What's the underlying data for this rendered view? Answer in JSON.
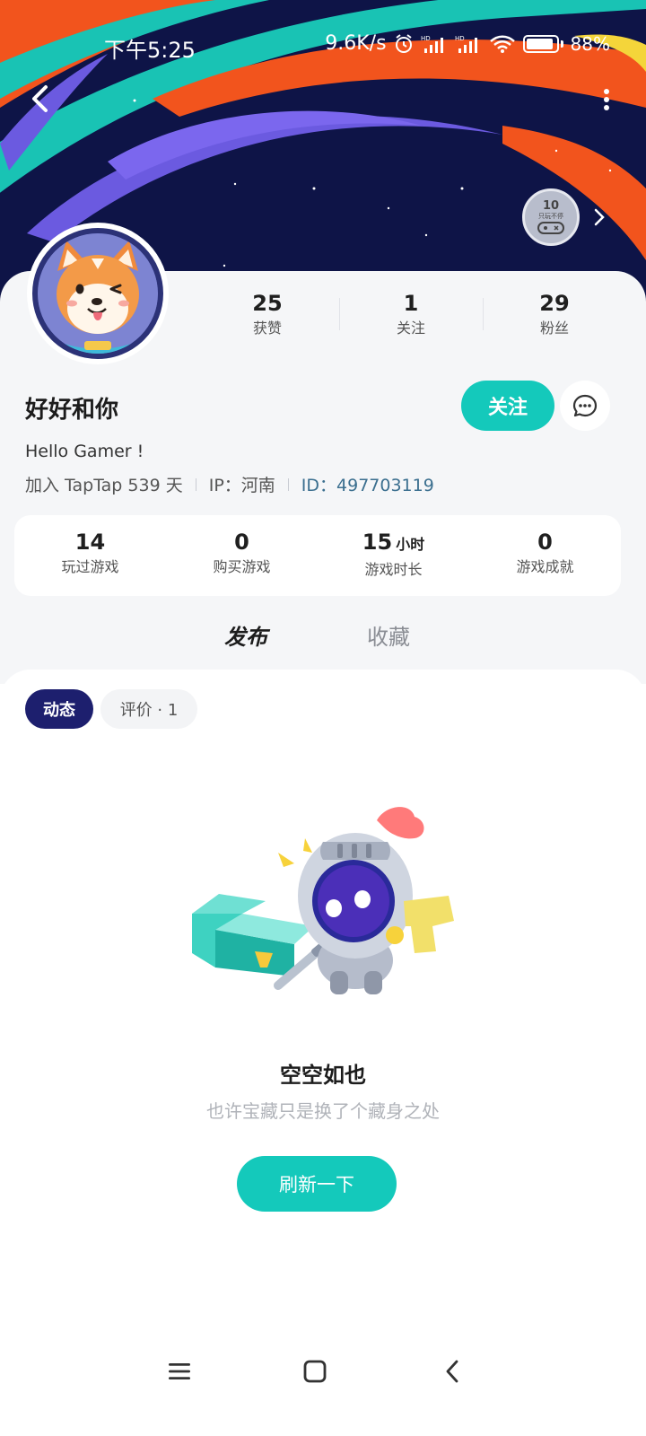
{
  "status_bar": {
    "time": "下午5:25",
    "net_speed": "9.6K/s",
    "hd_label": "HD",
    "battery_percent": "88%"
  },
  "header": {
    "badge_level": "10",
    "badge_caption": "只玩不停"
  },
  "profile": {
    "name": "好好和你",
    "bio": "Hello Gamer !",
    "joined": "加入 TapTap 539 天",
    "ip": "IP：河南",
    "id": "ID：497703119",
    "follow_label": "关注"
  },
  "stats": [
    {
      "value": "25",
      "label": "获赞"
    },
    {
      "value": "1",
      "label": "关注"
    },
    {
      "value": "29",
      "label": "粉丝"
    }
  ],
  "game_stats": [
    {
      "value": "14",
      "unit": "",
      "label": "玩过游戏"
    },
    {
      "value": "0",
      "unit": "",
      "label": "购买游戏"
    },
    {
      "value": "15",
      "unit": "小时",
      "label": "游戏时长"
    },
    {
      "value": "0",
      "unit": "",
      "label": "游戏成就"
    }
  ],
  "tabs": [
    {
      "label": "发布",
      "active": true
    },
    {
      "label": "收藏",
      "active": false
    }
  ],
  "filters": [
    {
      "label": "动态",
      "active": true
    },
    {
      "label": "评价 · 1",
      "active": false
    }
  ],
  "empty_state": {
    "title": "空空如也",
    "subtitle": "也许宝藏只是换了个藏身之处",
    "button": "刷新一下"
  },
  "colors": {
    "accent": "#14c9bb",
    "chip_active": "#1d1f6e",
    "banner_bg": "#0e1447"
  }
}
